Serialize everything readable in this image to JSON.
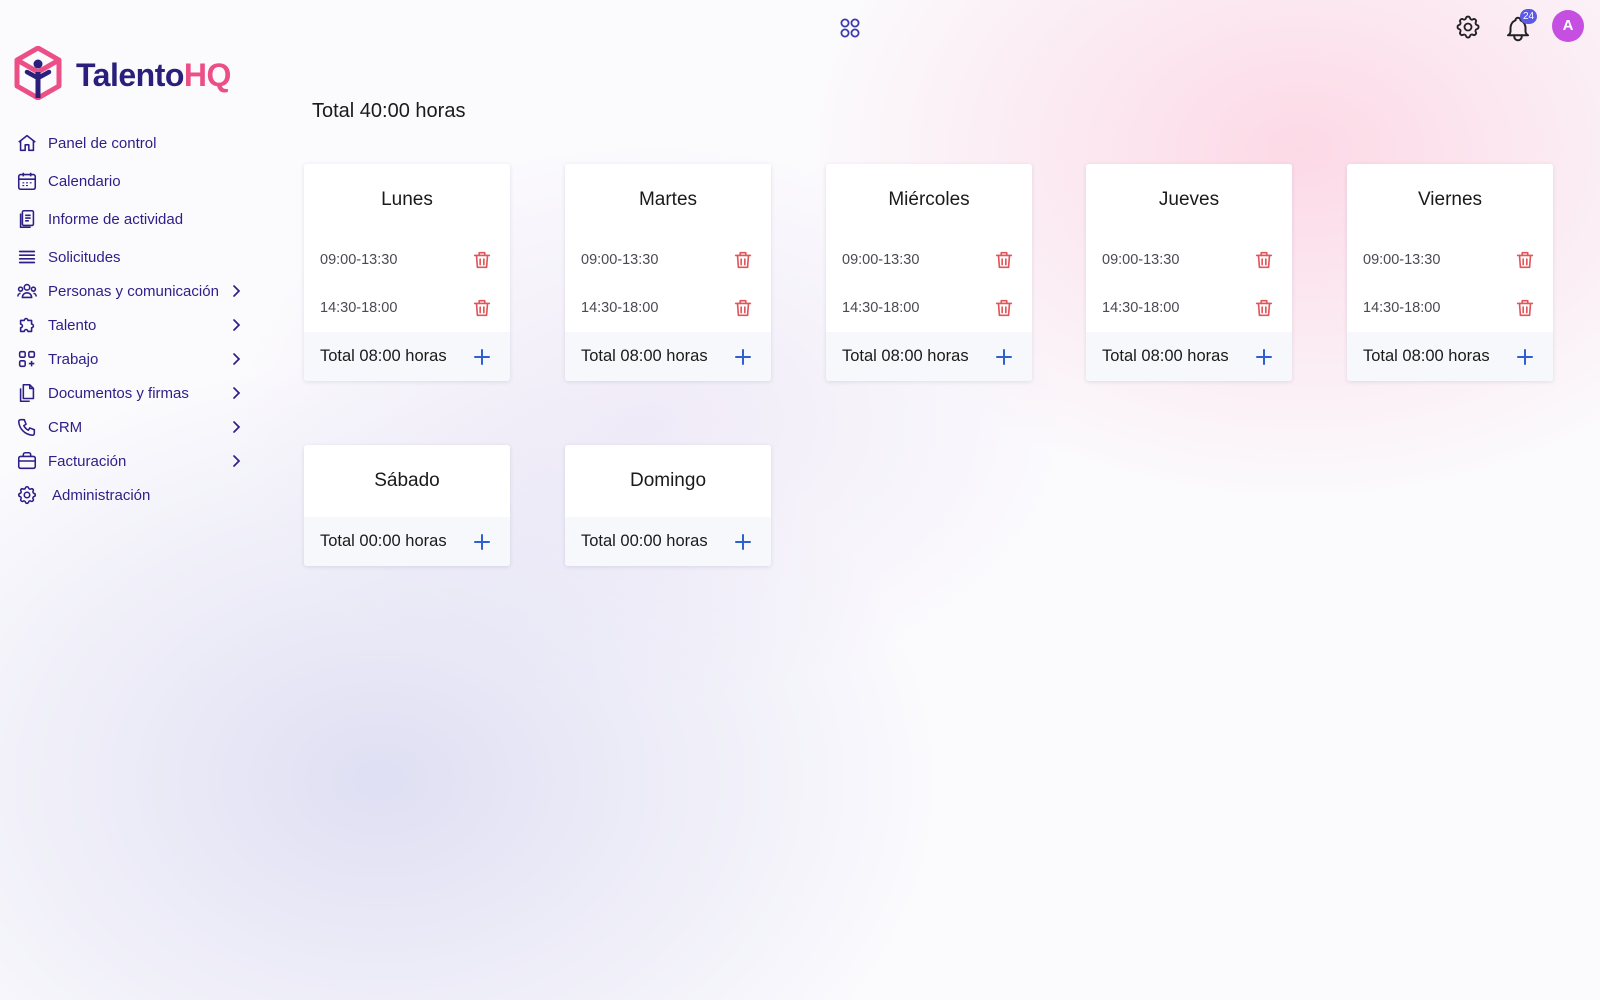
{
  "app": {
    "logo_part1": "Talento",
    "logo_part2": "HQ",
    "notifications_count": "24",
    "avatar_initial": "A"
  },
  "sidebar": {
    "items": [
      {
        "label": "Panel de control",
        "icon": "home-icon"
      },
      {
        "label": "Calendario",
        "icon": "calendar-icon"
      },
      {
        "label": "Informe de actividad",
        "icon": "report-icon"
      },
      {
        "label": "Solicitudes",
        "icon": "list-icon"
      },
      {
        "label": "Personas y comunicación",
        "icon": "people-icon"
      },
      {
        "label": "Talento",
        "icon": "puzzle-icon"
      },
      {
        "label": "Trabajo",
        "icon": "grid-icon"
      },
      {
        "label": "Documentos y firmas",
        "icon": "documents-icon"
      },
      {
        "label": "CRM",
        "icon": "phone-icon"
      },
      {
        "label": "Facturación",
        "icon": "briefcase-icon"
      },
      {
        "label": "Administración",
        "icon": "gear-icon"
      }
    ]
  },
  "main": {
    "total_label": "Total 40:00 horas",
    "days": [
      {
        "name": "Lunes",
        "slots": [
          "09:00-13:30",
          "14:30-18:00"
        ],
        "total": "Total 08:00 horas"
      },
      {
        "name": "Martes",
        "slots": [
          "09:00-13:30",
          "14:30-18:00"
        ],
        "total": "Total 08:00 horas"
      },
      {
        "name": "Miércoles",
        "slots": [
          "09:00-13:30",
          "14:30-18:00"
        ],
        "total": "Total 08:00 horas"
      },
      {
        "name": "Jueves",
        "slots": [
          "09:00-13:30",
          "14:30-18:00"
        ],
        "total": "Total 08:00 horas"
      },
      {
        "name": "Viernes",
        "slots": [
          "09:00-13:30",
          "14:30-18:00"
        ],
        "total": "Total 08:00 horas"
      },
      {
        "name": "Sábado",
        "slots": [],
        "total": "Total 00:00 horas"
      },
      {
        "name": "Domingo",
        "slots": [],
        "total": "Total 00:00 horas"
      }
    ]
  },
  "colors": {
    "nav_text": "#2d1f87",
    "logo_pink": "#ec4f86",
    "trash_red": "#e0565b",
    "plus_blue": "#2f5fd0",
    "avatar": "#c44fe0"
  }
}
